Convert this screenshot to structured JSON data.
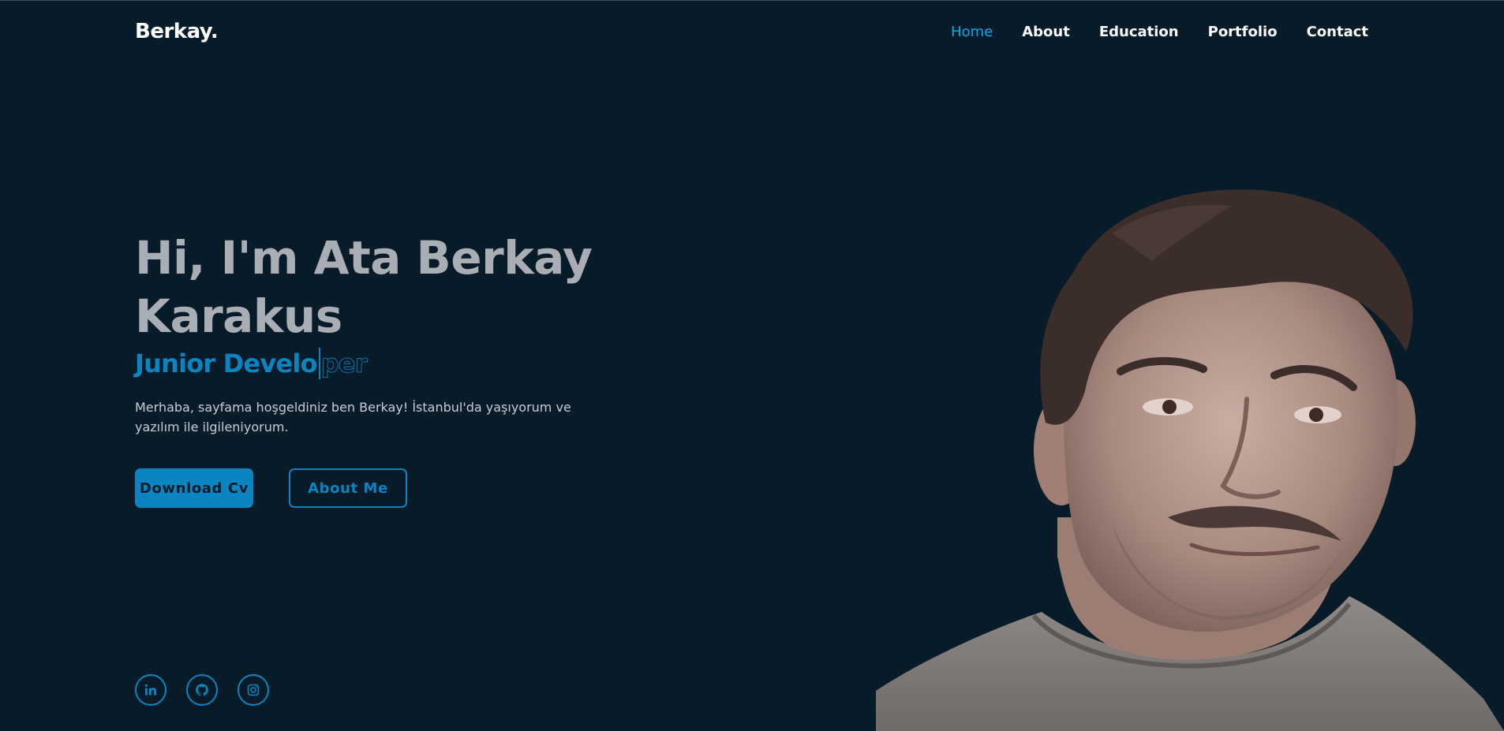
{
  "header": {
    "logo": "Berkay.",
    "nav": [
      {
        "label": "Home",
        "active": true
      },
      {
        "label": "About",
        "active": false
      },
      {
        "label": "Education",
        "active": false
      },
      {
        "label": "Portfolio",
        "active": false
      },
      {
        "label": "Contact",
        "active": false
      }
    ]
  },
  "hero": {
    "title_line1": "Hi, I'm Ata Berkay",
    "title_line2": "Karakus",
    "subtitle_typed": "Junior Develo",
    "subtitle_remaining": "per",
    "intro": "Merhaba, sayfama hoşgeldiniz ben Berkay! İstanbul'da yaşıyorum ve yazılım ile ilgileniyorum."
  },
  "buttons": {
    "download_cv": "Download Cv",
    "about_me": "About Me"
  },
  "socials": [
    {
      "icon": "linkedin-icon"
    },
    {
      "icon": "github-icon"
    },
    {
      "icon": "instagram-icon"
    }
  ],
  "colors": {
    "background": "#081b29",
    "accent": "#0a85c2",
    "nav_active": "#00abf0",
    "title": "#a9aeb4"
  }
}
